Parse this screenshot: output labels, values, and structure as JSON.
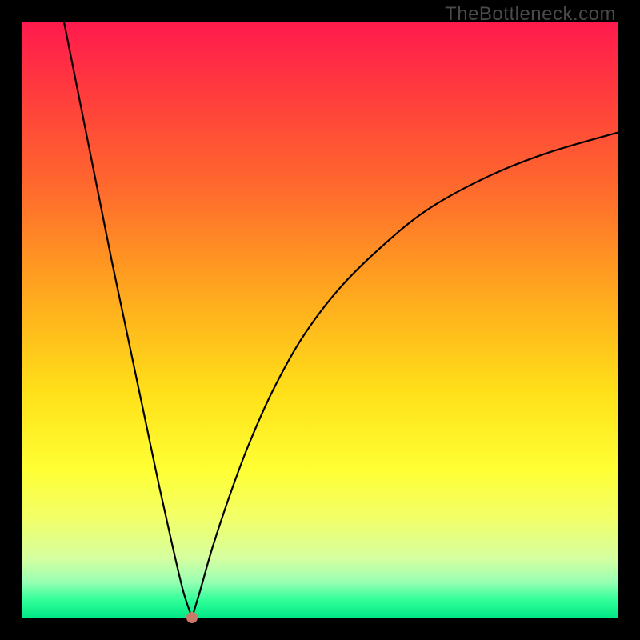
{
  "watermark": "TheBottleneck.com",
  "colors": {
    "frame": "#000000",
    "curve": "#000000",
    "marker": "#c97a6a",
    "gradient_top": "#ff1a4d",
    "gradient_bottom": "#00e885"
  },
  "chart_data": {
    "type": "line",
    "title": "",
    "xlabel": "",
    "ylabel": "",
    "xlim": [
      0,
      100
    ],
    "ylim": [
      0,
      100
    ],
    "left_branch": {
      "x": [
        7,
        9,
        11,
        13,
        15,
        17,
        19,
        21,
        23,
        25,
        27,
        28.5
      ],
      "y": [
        100,
        90,
        80,
        70,
        60,
        50.5,
        41,
        31.5,
        22,
        13,
        4.5,
        0
      ]
    },
    "right_branch": {
      "x": [
        28.5,
        30,
        32,
        35,
        38,
        42,
        47,
        53,
        60,
        68,
        78,
        88,
        100
      ],
      "y": [
        0,
        5,
        12,
        21,
        29,
        38,
        47,
        55,
        62,
        68.5,
        74,
        78,
        81.5
      ]
    },
    "marker": {
      "x": 28.5,
      "y": 0
    }
  }
}
